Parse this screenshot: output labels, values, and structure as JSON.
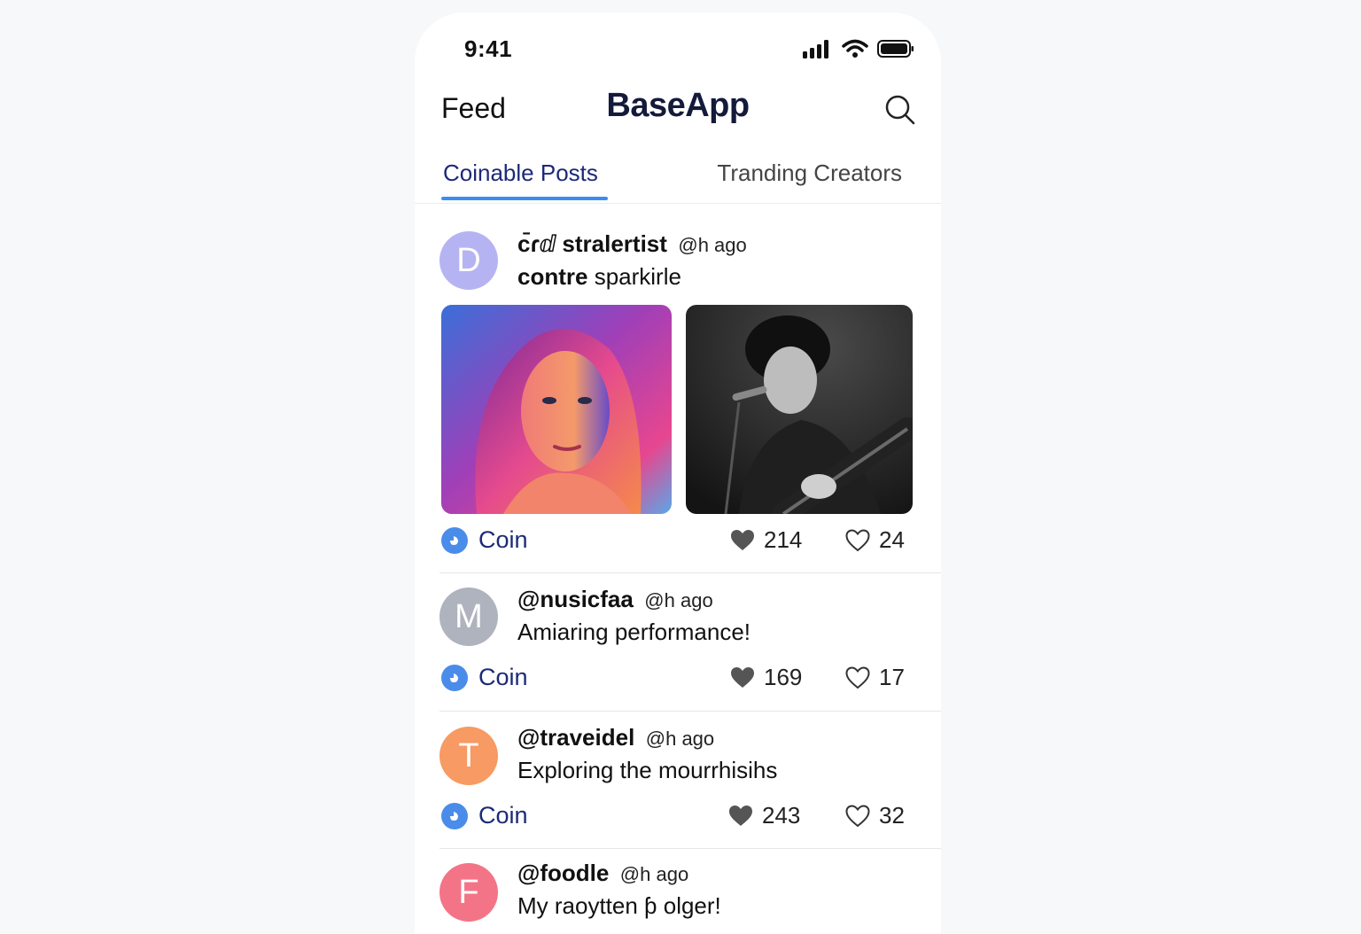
{
  "status": {
    "time": "9:41"
  },
  "header": {
    "left": "Feed",
    "title": "BaseApp"
  },
  "tabs": [
    {
      "label": "Coinable Posts",
      "active": true
    },
    {
      "label": "Tranding Creators",
      "active": false
    }
  ],
  "posts": [
    {
      "initial": "D",
      "avatar_color": "#b6b3f3",
      "username": "c̄ɾⅆ stralertist",
      "time": "@h ago",
      "text_bold": "contre",
      "text": " sparkirle",
      "coin_label": "Coin",
      "likes": "214",
      "comments": "24"
    },
    {
      "initial": "M",
      "avatar_color": "#aeb3bd",
      "username": "@nusicfaa",
      "time": "@h ago",
      "text_bold": "",
      "text": "Amiaring performance!",
      "coin_label": "Coin",
      "likes": "169",
      "comments": "17"
    },
    {
      "initial": "T",
      "avatar_color": "#f79a63",
      "username": "@traveidel",
      "time": "@h ago",
      "text_bold": "",
      "text": "Exploring the mourrhisihs",
      "coin_label": "Coin",
      "likes": "243",
      "comments": "32"
    },
    {
      "initial": "F",
      "avatar_color": "#f47487",
      "username": "@foodle",
      "time": "@h ago",
      "text_bold": "",
      "text": "My raoytten ƥ olger!",
      "coin_label": "",
      "likes": "",
      "comments": ""
    }
  ],
  "colors": {
    "accent": "#3b8cf2",
    "brand_dark": "#141a3a",
    "coin_blue": "#4a8cea"
  }
}
